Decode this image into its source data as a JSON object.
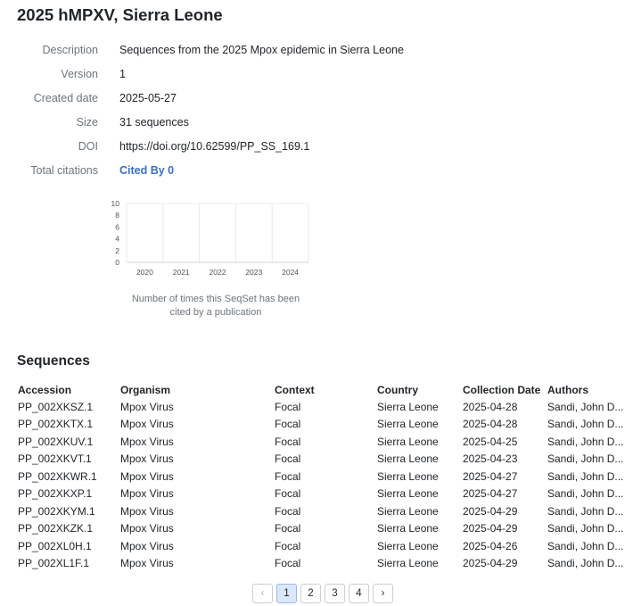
{
  "page": {
    "title": "2025 hMPXV, Sierra Leone"
  },
  "meta": [
    {
      "label": "Description",
      "value": "Sequences from the 2025 Mpox epidemic in Sierra Leone"
    },
    {
      "label": "Version",
      "value": "1"
    },
    {
      "label": "Created date",
      "value": "2025-05-27"
    },
    {
      "label": "Size",
      "value": "31 sequences"
    },
    {
      "label": "DOI",
      "value": "https://doi.org/10.62599/PP_SS_169.1"
    },
    {
      "label": "Total citations",
      "value": "Cited By 0"
    }
  ],
  "chart_data": {
    "type": "bar",
    "categories": [
      "2020",
      "2021",
      "2022",
      "2023",
      "2024"
    ],
    "values": [
      0,
      0,
      0,
      0,
      0
    ],
    "yticks": [
      0,
      2,
      4,
      6,
      8,
      10
    ],
    "ylim": [
      0,
      10
    ],
    "caption": "Number of times this SeqSet has been cited by a publication"
  },
  "sequences": {
    "title": "Sequences",
    "columns": [
      "Accession",
      "Organism",
      "Context",
      "Country",
      "Collection Date",
      "Authors"
    ],
    "rows": [
      [
        "PP_002XKSZ.1",
        "Mpox Virus",
        "Focal",
        "Sierra Leone",
        "2025-04-28",
        "Sandi, John D..."
      ],
      [
        "PP_002XKTX.1",
        "Mpox Virus",
        "Focal",
        "Sierra Leone",
        "2025-04-28",
        "Sandi, John D..."
      ],
      [
        "PP_002XKUV.1",
        "Mpox Virus",
        "Focal",
        "Sierra Leone",
        "2025-04-25",
        "Sandi, John D..."
      ],
      [
        "PP_002XKVT.1",
        "Mpox Virus",
        "Focal",
        "Sierra Leone",
        "2025-04-23",
        "Sandi, John D..."
      ],
      [
        "PP_002XKWR.1",
        "Mpox Virus",
        "Focal",
        "Sierra Leone",
        "2025-04-27",
        "Sandi, John D..."
      ],
      [
        "PP_002XKXP.1",
        "Mpox Virus",
        "Focal",
        "Sierra Leone",
        "2025-04-27",
        "Sandi, John D..."
      ],
      [
        "PP_002XKYM.1",
        "Mpox Virus",
        "Focal",
        "Sierra Leone",
        "2025-04-29",
        "Sandi, John D..."
      ],
      [
        "PP_002XKZK.1",
        "Mpox Virus",
        "Focal",
        "Sierra Leone",
        "2025-04-29",
        "Sandi, John D..."
      ],
      [
        "PP_002XL0H.1",
        "Mpox Virus",
        "Focal",
        "Sierra Leone",
        "2025-04-26",
        "Sandi, John D..."
      ],
      [
        "PP_002XL1F.1",
        "Mpox Virus",
        "Focal",
        "Sierra Leone",
        "2025-04-29",
        "Sandi, John D..."
      ]
    ]
  },
  "pagination": {
    "prev": "‹",
    "next": "›",
    "pages": [
      "1",
      "2",
      "3",
      "4"
    ],
    "current": "1"
  }
}
